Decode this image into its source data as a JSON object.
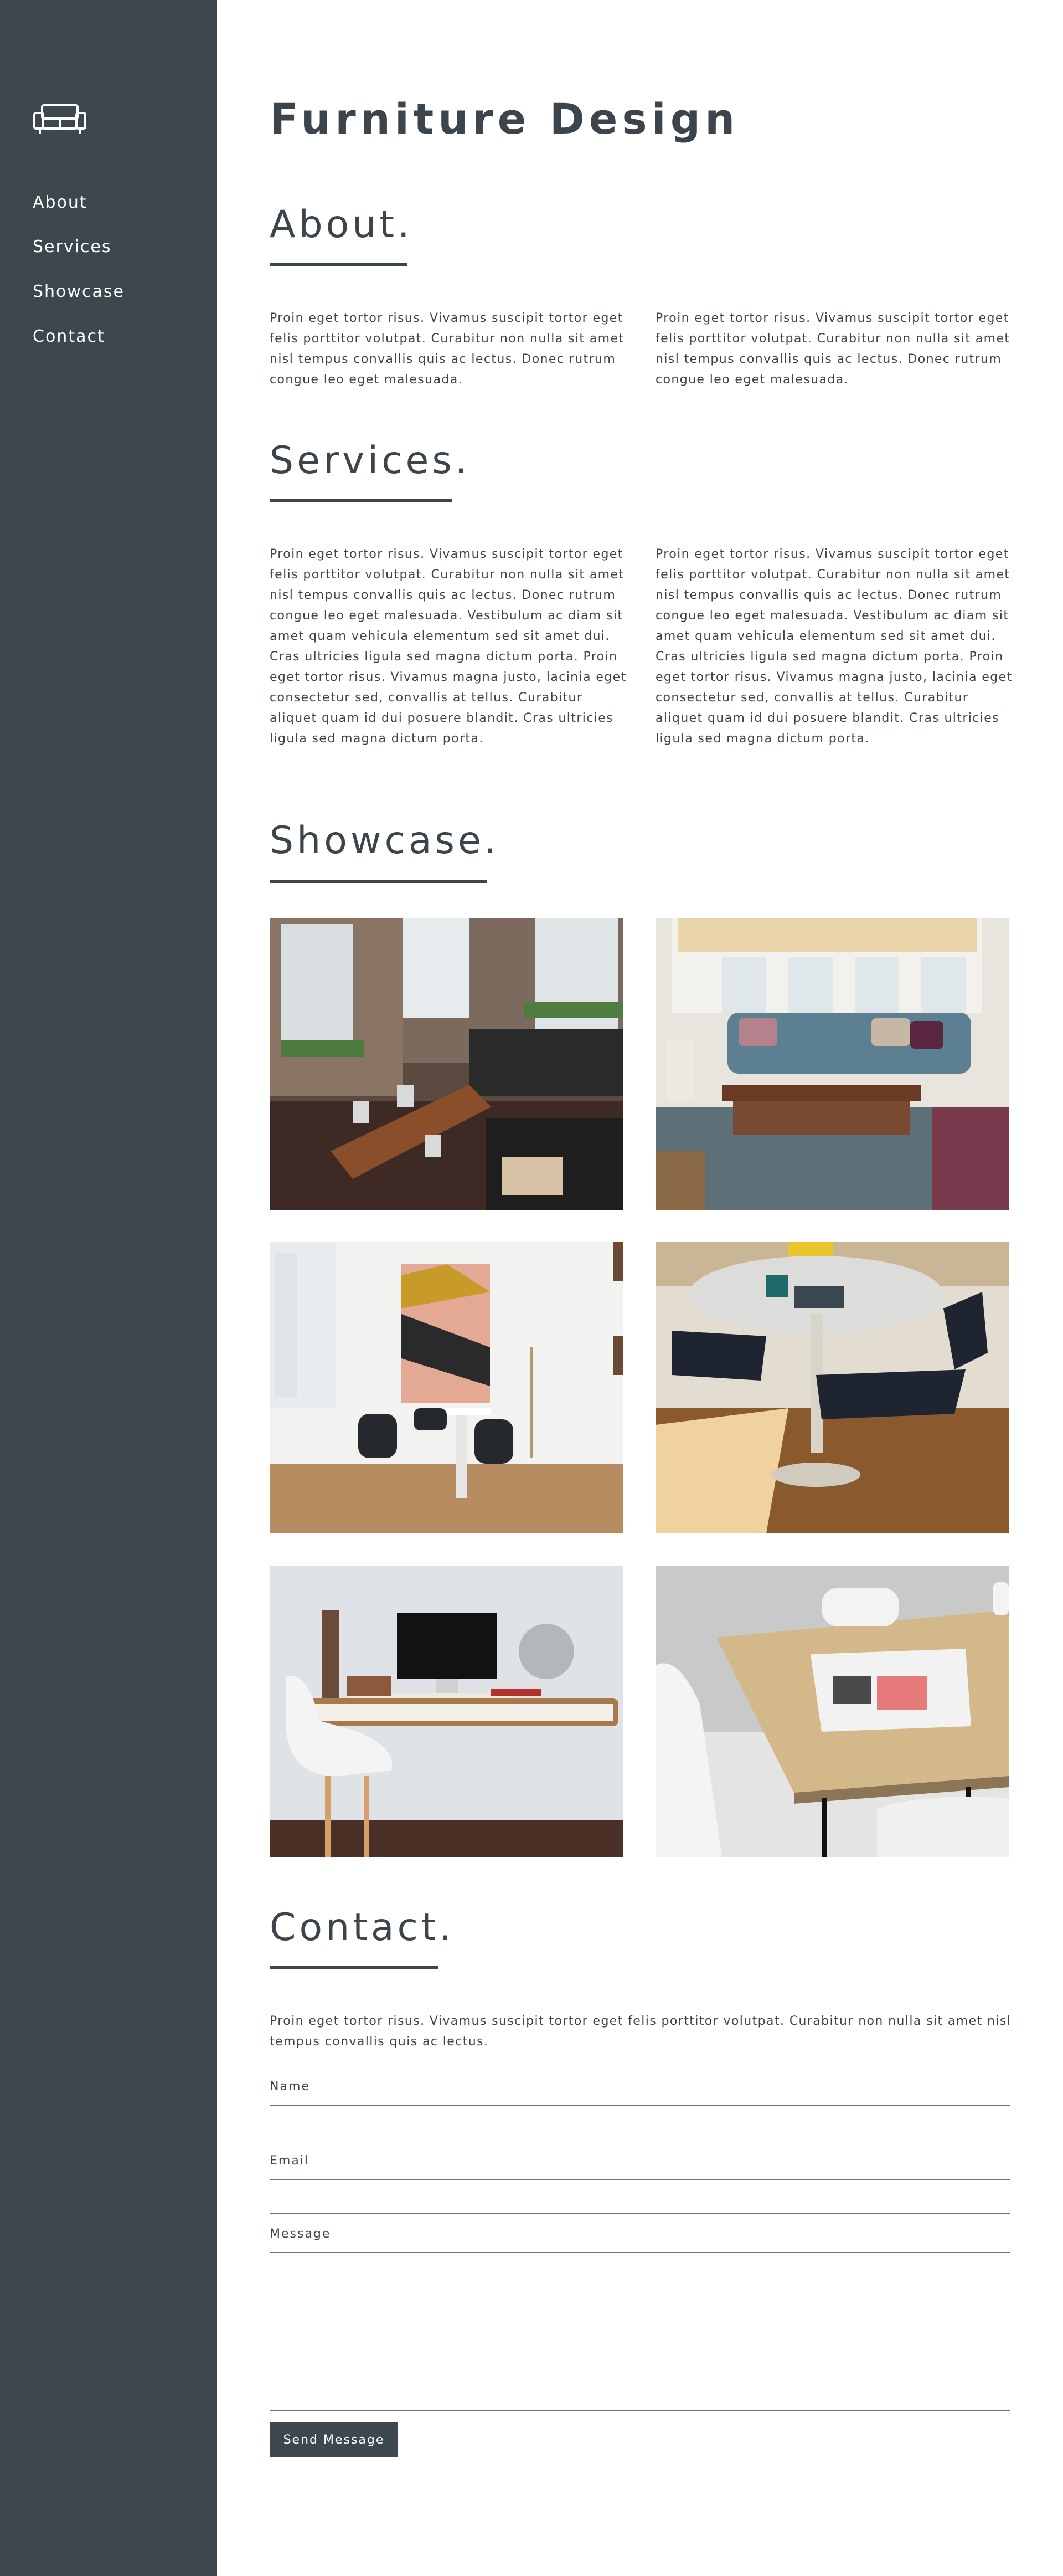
{
  "sidebar": {
    "logo_icon": "sofa-icon",
    "nav": [
      {
        "label": "About"
      },
      {
        "label": "Services"
      },
      {
        "label": "Showcase"
      },
      {
        "label": "Contact"
      }
    ]
  },
  "header": {
    "title": "Furniture Design"
  },
  "about": {
    "title": "About.",
    "paragraphs": [
      "Proin eget tortor risus. Vivamus suscipit tortor eget felis porttitor volutpat. Curabitur non nulla sit amet nisl tempus convallis quis ac lectus. Donec rutrum congue leo eget malesuada.",
      "Proin eget tortor risus. Vivamus suscipit tortor eget felis porttitor volutpat. Curabitur non nulla sit amet nisl tempus convallis quis ac lectus. Donec rutrum congue leo eget malesuada."
    ]
  },
  "services": {
    "title": "Services.",
    "paragraphs": [
      "Proin eget tortor risus. Vivamus suscipit tortor eget felis porttitor volutpat. Curabitur non nulla sit amet nisl tempus convallis quis ac lectus. Donec rutrum congue leo eget malesuada. Vestibulum ac diam sit amet quam vehicula elementum sed sit amet dui. Cras ultricies ligula sed magna dictum porta. Proin eget tortor risus. Vivamus magna justo, lacinia eget consectetur sed, convallis at tellus. Curabitur aliquet quam id dui posuere blandit. Cras ultricies ligula sed magna dictum porta.",
      "Proin eget tortor risus. Vivamus suscipit tortor eget felis porttitor volutpat. Curabitur non nulla sit amet nisl tempus convallis quis ac lectus. Donec rutrum congue leo eget malesuada. Vestibulum ac diam sit amet quam vehicula elementum sed sit amet dui. Cras ultricies ligula sed magna dictum porta. Proin eget tortor risus. Vivamus magna justo, lacinia eget consectetur sed, convallis at tellus. Curabitur aliquet quam id dui posuere blandit. Cras ultricies ligula sed magna dictum porta."
    ]
  },
  "showcase": {
    "title": "Showcase.",
    "images": [
      {
        "subject": "loft-dining-room"
      },
      {
        "subject": "living-room-sofa"
      },
      {
        "subject": "white-dining-nook"
      },
      {
        "subject": "round-table-chairs"
      },
      {
        "subject": "wall-desk-workspace"
      },
      {
        "subject": "wood-table-magazine"
      }
    ]
  },
  "contact": {
    "title": "Contact.",
    "intro": "Proin eget tortor risus. Vivamus suscipit tortor eget felis porttitor volutpat. Curabitur non nulla sit amet nisl tempus convallis quis ac lectus.",
    "name_label": "Name",
    "name_value": "",
    "email_label": "Email",
    "email_value": "",
    "message_label": "Message",
    "message_value": "",
    "send_label": "Send Message"
  },
  "colors": {
    "sidebar": "#3d474e",
    "text": "#3d454c",
    "background": "#ffffff"
  }
}
